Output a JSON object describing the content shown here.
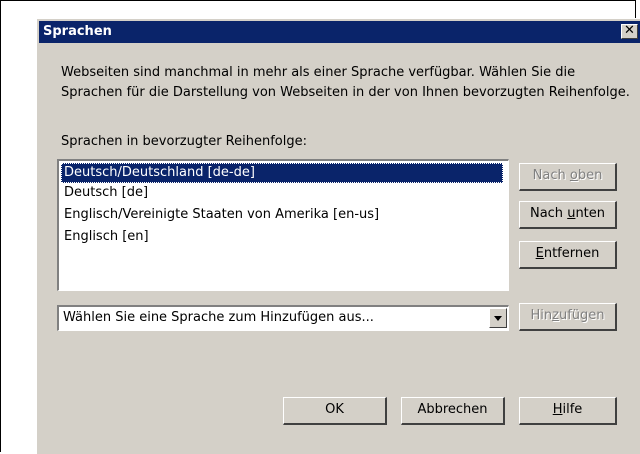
{
  "dialog": {
    "title": "Sprachen",
    "close_glyph": "✕",
    "intro_text": "Webseiten sind manchmal in mehr als einer Sprache verfügbar. Wählen Sie die Sprachen für die Darstellung von Webseiten in der von Ihnen bevorzugten Reihenfolge.",
    "list_label": "Sprachen in bevorzugter Reihenfolge:",
    "languages": [
      {
        "label": "Deutsch/Deutschland  [de-de]",
        "selected": true
      },
      {
        "label": "Deutsch  [de]",
        "selected": false
      },
      {
        "label": "Englisch/Vereinigte Staaten von Amerika  [en-us]",
        "selected": false
      },
      {
        "label": "Englisch  [en]",
        "selected": false
      }
    ],
    "buttons": {
      "move_up": {
        "pre": "Nach ",
        "key": "o",
        "post": "ben"
      },
      "move_down": {
        "pre": "Nach ",
        "key": "u",
        "post": "nten"
      },
      "remove": {
        "pre": "",
        "key": "E",
        "post": "ntfernen"
      },
      "add": {
        "pre": "Hin",
        "key": "z",
        "post": "ufügen"
      },
      "ok": "OK",
      "cancel": "Abbrechen",
      "help": {
        "pre": "",
        "key": "H",
        "post": "ilfe"
      }
    },
    "add_language_select": {
      "value": "Wählen Sie eine Sprache zum Hinzufügen aus..."
    },
    "colors": {
      "titlebar": "#0a246a",
      "face": "#d4d0c8",
      "selection": "#0a246a"
    }
  }
}
